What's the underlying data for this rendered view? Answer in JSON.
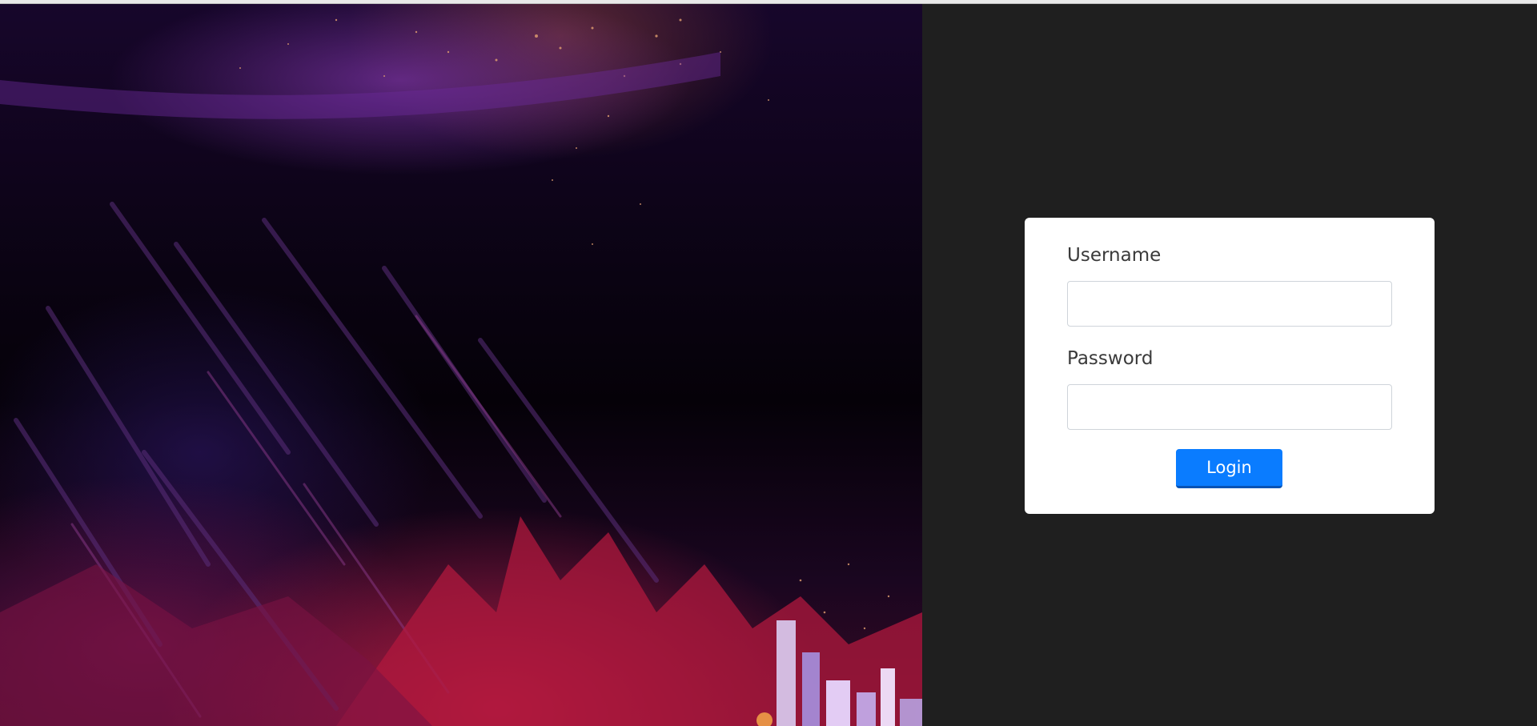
{
  "login_form": {
    "username_label": "Username",
    "username_value": "",
    "password_label": "Password",
    "password_value": "",
    "login_label": "Login"
  },
  "colors": {
    "page_background": "#1f1f1f",
    "card_background": "#ffffff",
    "button_primary": "#0a7cff"
  }
}
